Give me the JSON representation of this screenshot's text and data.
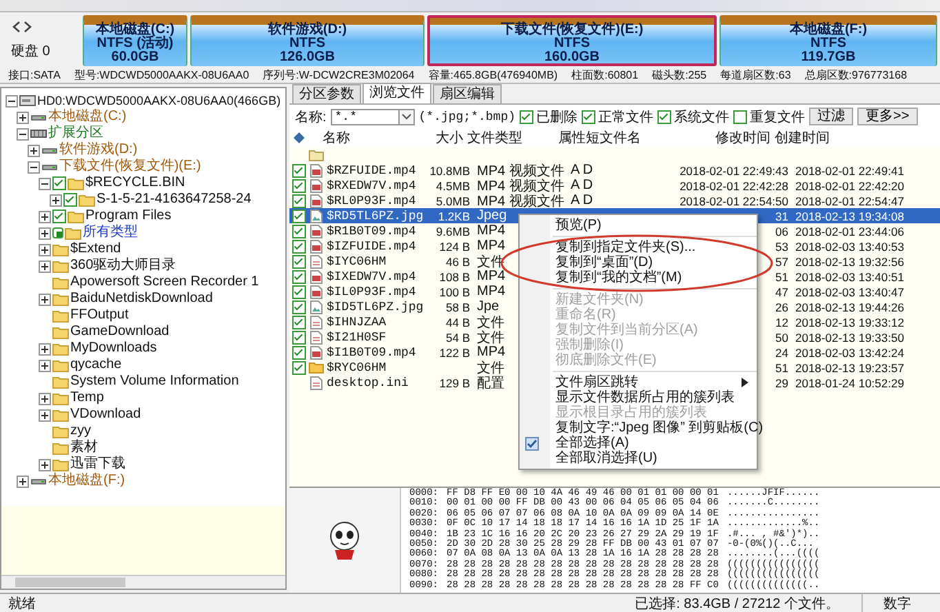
{
  "disk_bar": {
    "label": "硬盘 0",
    "partitions": [
      {
        "name": "本地磁盘(C:)",
        "fs": "NTFS (活动)",
        "size": "60.0GB",
        "selected": false
      },
      {
        "name": "软件游戏(D:)",
        "fs": "NTFS",
        "size": "126.0GB",
        "selected": false
      },
      {
        "name": "下载文件(恢复文件)(E:)",
        "fs": "NTFS",
        "size": "160.0GB",
        "selected": true
      },
      {
        "name": "本地磁盘(F:)",
        "fs": "NTFS",
        "size": "119.7GB",
        "selected": false
      }
    ]
  },
  "disk_info": [
    "接口:SATA",
    "型号:WDCWD5000AAKX-08U6AA0",
    "序列号:W-DCW2CRE3M02064",
    "容量:465.8GB(476940MB)",
    "柱面数:60801",
    "磁头数:255",
    "每道扇区数:63",
    "总扇区数:976773168"
  ],
  "tree": [
    {
      "kind": "disk",
      "label": "HD0:WDCWD5000AAKX-08U6AA0(466GB)",
      "expanded": true,
      "children": [
        {
          "kind": "partition",
          "label": "本地磁盘(C:)",
          "expanded": false
        },
        {
          "kind": "extended",
          "label": "扩展分区",
          "expanded": true,
          "children": [
            {
              "kind": "partition",
              "label": "软件游戏(D:)",
              "expanded": false
            },
            {
              "kind": "partition",
              "label": "下载文件(恢复文件)(E:)",
              "expanded": true,
              "children": [
                {
                  "kind": "folder",
                  "label": "$RECYCLE.BIN",
                  "expanded": true,
                  "checked": true,
                  "children": [
                    {
                      "kind": "folder",
                      "label": "S-1-5-21-4163647258-24",
                      "expanded": false,
                      "checked": true
                    }
                  ]
                },
                {
                  "kind": "folder",
                  "label": "Program Files",
                  "expanded": false,
                  "checked": true
                },
                {
                  "kind": "filter",
                  "label": "所有类型",
                  "expanded": false,
                  "partial": true
                },
                {
                  "kind": "folder",
                  "label": "$Extend",
                  "expanded": false
                },
                {
                  "kind": "folder",
                  "label": "360驱动大师目录",
                  "expanded": false
                },
                {
                  "kind": "folder",
                  "label": "Apowersoft Screen Recorder 1"
                },
                {
                  "kind": "folder",
                  "label": "BaiduNetdiskDownload",
                  "expanded": false
                },
                {
                  "kind": "folder",
                  "label": "FFOutput"
                },
                {
                  "kind": "folder",
                  "label": "GameDownload"
                },
                {
                  "kind": "folder",
                  "label": "MyDownloads",
                  "expanded": false
                },
                {
                  "kind": "folder",
                  "label": "qycache",
                  "expanded": false
                },
                {
                  "kind": "folder",
                  "label": "System Volume Information"
                },
                {
                  "kind": "folder",
                  "label": "Temp",
                  "expanded": false
                },
                {
                  "kind": "folder",
                  "label": "VDownload",
                  "expanded": false
                },
                {
                  "kind": "folder",
                  "label": "zyy"
                },
                {
                  "kind": "folder",
                  "label": "素材"
                },
                {
                  "kind": "folder",
                  "label": "迅雷下载",
                  "expanded": false
                }
              ]
            }
          ]
        },
        {
          "kind": "partition",
          "label": "本地磁盘(F:)",
          "expanded": false
        }
      ]
    }
  ],
  "tabs": [
    {
      "label": "分区参数",
      "selected": false
    },
    {
      "label": "浏览文件",
      "selected": true
    },
    {
      "label": "扇区编辑",
      "selected": false
    }
  ],
  "filter": {
    "label": "名称:",
    "value": "*.*",
    "hint": "(*.jpg;*.bmp)",
    "options": [
      {
        "label": "已删除",
        "checked": true
      },
      {
        "label": "正常文件",
        "checked": true
      },
      {
        "label": "系统文件",
        "checked": true
      },
      {
        "label": "重复文件",
        "checked": false
      }
    ],
    "buttons": [
      "过滤",
      "更多>>"
    ]
  },
  "table": {
    "columns": [
      "名称",
      "大小",
      "文件类型",
      "属性",
      "短文件名",
      "修改时间",
      "创建时间"
    ],
    "rows": [
      {
        "kind": "parent-folder",
        "selected": false
      },
      {
        "kind": "video",
        "checked": true,
        "selected": false,
        "name": "$RZFUIDE.mp4",
        "size": "10.8MB",
        "type": "MP4 视频文件",
        "attributes": "A D",
        "modified": "2018-02-01 22:49:43",
        "created": "2018-02-01 22:49:41"
      },
      {
        "kind": "video",
        "checked": true,
        "selected": false,
        "name": "$RXEDW7V.mp4",
        "size": "4.5MB",
        "type": "MP4 视频文件",
        "attributes": "A D",
        "modified": "2018-02-01 22:42:28",
        "created": "2018-02-01 22:42:20"
      },
      {
        "kind": "video",
        "checked": true,
        "selected": false,
        "name": "$RL0P93F.mp4",
        "size": "5.0MB",
        "type": "MP4 视频文件",
        "attributes": "A D",
        "modified": "2018-02-01 22:54:50",
        "created": "2018-02-01 22:54:47"
      },
      {
        "kind": "image",
        "checked": true,
        "selected": true,
        "name": "$RD5TL6PZ.jpg",
        "size": "1.2KB",
        "type": "Jpeg",
        "modified": "31",
        "created": "2018-02-13 19:34:08"
      },
      {
        "kind": "video",
        "checked": true,
        "selected": false,
        "name": "$R1B0T09.mp4",
        "size": "9.6MB",
        "type": "MP4",
        "modified": "06",
        "created": "2018-02-01 23:44:06"
      },
      {
        "kind": "video",
        "checked": true,
        "selected": false,
        "name": "$IZFUIDE.mp4",
        "size": "124 B",
        "type": "MP4",
        "modified": "53",
        "created": "2018-02-03 13:40:53"
      },
      {
        "kind": "file",
        "checked": true,
        "selected": false,
        "name": "$IYC06HM",
        "size": "46 B",
        "type": "文件",
        "modified": "57",
        "created": "2018-02-13 19:32:56"
      },
      {
        "kind": "video",
        "checked": true,
        "selected": false,
        "name": "$IXEDW7V.mp4",
        "size": "108 B",
        "type": "MP4",
        "modified": "51",
        "created": "2018-02-03 13:40:51"
      },
      {
        "kind": "video",
        "checked": true,
        "selected": false,
        "name": "$IL0P93F.mp4",
        "size": "100 B",
        "type": "MP4",
        "modified": "47",
        "created": "2018-02-03 13:40:47"
      },
      {
        "kind": "image",
        "checked": true,
        "selected": false,
        "name": "$ID5TL6PZ.jpg",
        "size": "58 B",
        "type": "Jpe",
        "modified": "26",
        "created": "2018-02-13 19:44:26"
      },
      {
        "kind": "file",
        "checked": true,
        "selected": false,
        "name": "$IHNJZAA",
        "size": "44 B",
        "type": "文件",
        "modified": "12",
        "created": "2018-02-13 19:33:12"
      },
      {
        "kind": "file",
        "checked": true,
        "selected": false,
        "name": "$I21H0SF",
        "size": "54 B",
        "type": "文件",
        "modified": "50",
        "created": "2018-02-13 19:33:50"
      },
      {
        "kind": "video",
        "checked": true,
        "selected": false,
        "name": "$I1B0T09.mp4",
        "size": "122 B",
        "type": "MP4",
        "modified": "24",
        "created": "2018-02-03 13:42:24"
      },
      {
        "kind": "folder",
        "checked": true,
        "selected": false,
        "name": "$RYC06HM",
        "type": "文件",
        "modified": "51",
        "created": "2018-02-13 19:23:57"
      },
      {
        "kind": "config",
        "selected": false,
        "name": "desktop.ini",
        "size": "129 B",
        "type": "配置",
        "modified": "29",
        "created": "2018-01-24 10:52:29"
      }
    ]
  },
  "context_menu": [
    {
      "kind": "item",
      "label": "预览(P)",
      "disabled": false
    },
    {
      "kind": "separator"
    },
    {
      "kind": "item",
      "label": "复制到指定文件夹(S)...",
      "disabled": false
    },
    {
      "kind": "item",
      "label": "复制到“桌面”(D)",
      "disabled": false
    },
    {
      "kind": "item",
      "label": "复制到“我的文档”(M)",
      "disabled": false
    },
    {
      "kind": "separator"
    },
    {
      "kind": "item",
      "label": "新建文件夹(N)",
      "disabled": true
    },
    {
      "kind": "item",
      "label": "重命名(R)",
      "disabled": true
    },
    {
      "kind": "item",
      "label": "复制文件到当前分区(A)",
      "disabled": true
    },
    {
      "kind": "item",
      "label": "强制删除(I)",
      "disabled": true
    },
    {
      "kind": "item",
      "label": "彻底删除文件(E)",
      "disabled": true
    },
    {
      "kind": "separator"
    },
    {
      "kind": "submenu",
      "label": "文件扇区跳转",
      "disabled": false
    },
    {
      "kind": "item",
      "label": "显示文件数据所占用的簇列表",
      "disabled": false
    },
    {
      "kind": "item",
      "label": "显示根目录占用的簇列表",
      "disabled": true
    },
    {
      "kind": "item",
      "label": "复制文字:“Jpeg 图像” 到剪贴板(C)",
      "disabled": false
    },
    {
      "kind": "checked-item",
      "label": "全部选择(A)",
      "disabled": false
    },
    {
      "kind": "item",
      "label": "全部取消选择(U)",
      "disabled": false
    }
  ],
  "hex": [
    {
      "offset": "0000:",
      "bytes": "FF D8 FF E0 00 10 4A 46 49 46 00 01 01 00 00 01",
      "ascii": "......JFIF......"
    },
    {
      "offset": "0010:",
      "bytes": "00 01 00 00 FF DB 00 43 00 06 04 05 06 05 04 06",
      "ascii": ".......C........"
    },
    {
      "offset": "0020:",
      "bytes": "06 05 06 07 07 06 08 0A 10 0A 0A 09 09 0A 14 0E",
      "ascii": "................"
    },
    {
      "offset": "0030:",
      "bytes": "0F 0C 10 17 14 18 18 17 14 16 16 1A 1D 25 1F 1A",
      "ascii": ".............%.."
    },
    {
      "offset": "0040:",
      "bytes": "1B 23 1C 16 16 20 2C 20 23 26 27 29 2A 29 19 1F",
      "ascii": ".#... , #&')*).."
    },
    {
      "offset": "0050:",
      "bytes": "2D 30 2D 28 30 25 28 29 28 FF DB 00 43 01 07 07",
      "ascii": "-0-(0%()(..C..."
    },
    {
      "offset": "0060:",
      "bytes": "07 0A 08 0A 13 0A 0A 13 28 1A 16 1A 28 28 28 28",
      "ascii": "........(...(((("
    },
    {
      "offset": "0070:",
      "bytes": "28 28 28 28 28 28 28 28 28 28 28 28 28 28 28 28",
      "ascii": "(((((((((((((((("
    },
    {
      "offset": "0080:",
      "bytes": "28 28 28 28 28 28 28 28 28 28 28 28 28 28 28 28",
      "ascii": "(((((((((((((((("
    },
    {
      "offset": "0090:",
      "bytes": "28 28 28 28 28 28 28 28 28 28 28 28 28 28 FF C0",
      "ascii": "((((((((((((((.."
    }
  ],
  "status_bar": [
    "就绪",
    "已选择: 83.4GB / 27212 个文件。",
    "数字"
  ]
}
